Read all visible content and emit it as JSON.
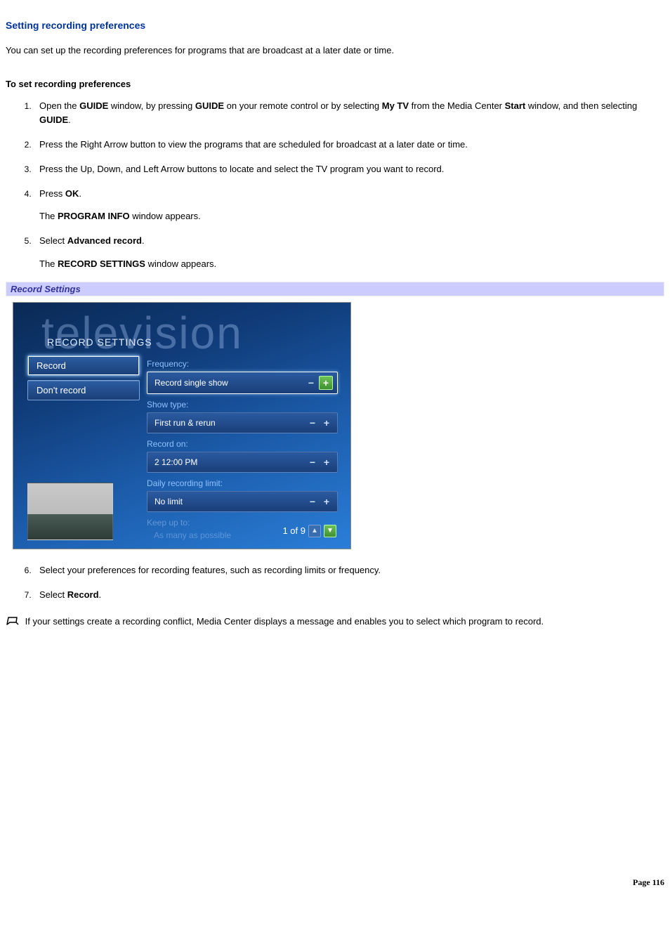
{
  "heading": "Setting recording preferences",
  "intro": "You can set up the recording preferences for programs that are broadcast at a later date or time.",
  "subhead": "To set recording preferences",
  "steps": {
    "s1": {
      "pre": "Open the ",
      "b1": "GUIDE",
      "mid1": " window, by pressing ",
      "b2": "GUIDE",
      "mid2": " on your remote control or by selecting ",
      "b3": "My TV",
      "mid3": " from the Media Center ",
      "b4": "Start",
      "mid4": " window, and then selecting ",
      "b5": "GUIDE",
      "post": "."
    },
    "s2": "Press the Right Arrow button to view the programs that are scheduled for broadcast at a later date or time.",
    "s3": "Press the Up, Down, and Left Arrow buttons to locate and select the TV program you want to record.",
    "s4": {
      "pre": "Press ",
      "b1": "OK",
      "post": "."
    },
    "s4_note": {
      "pre": "The ",
      "b1": "PROGRAM INFO",
      "post": " window appears."
    },
    "s5": {
      "pre": "Select ",
      "b1": "Advanced record",
      "post": "."
    },
    "s5_note": {
      "pre": "The ",
      "b1": "RECORD SETTINGS",
      "post": " window appears."
    },
    "s6": "Select your preferences for recording features, such as recording limits or frequency.",
    "s7": {
      "pre": "Select ",
      "b1": "Record",
      "post": "."
    }
  },
  "caption": "Record Settings",
  "shot": {
    "watermark": "television",
    "title": "RECORD SETTINGS",
    "buttons": {
      "record": "Record",
      "dont": "Don't record"
    },
    "rows": [
      {
        "label": "Frequency:",
        "value": "Record single show",
        "highlighted": true
      },
      {
        "label": "Show type:",
        "value": "First run & rerun"
      },
      {
        "label": "Record on:",
        "value": "2 12:00 PM"
      },
      {
        "label": "Daily recording limit:",
        "value": "No limit"
      },
      {
        "label": "Keep up to:",
        "value": "As many as possible",
        "faded": true
      }
    ],
    "pager": "1 of 9"
  },
  "note": "If your settings create a recording conflict, Media Center displays a message and enables you to select which program to record.",
  "page": "Page 116"
}
